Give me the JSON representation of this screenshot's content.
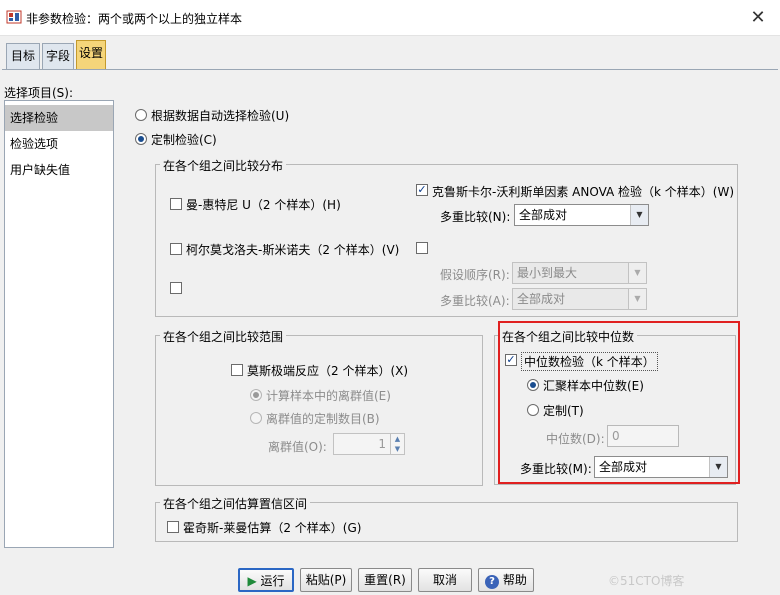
{
  "window": {
    "title": "非参数检验：两个或两个以上的独立样本",
    "close_glyph": "✕"
  },
  "tabs": [
    {
      "label": "目标",
      "active": false
    },
    {
      "label": "字段",
      "active": false
    },
    {
      "label": "设置",
      "active": true
    }
  ],
  "left_panel": {
    "heading": "选择项目(S):",
    "items": [
      {
        "label": "选择检验",
        "selected": true
      },
      {
        "label": "检验选项",
        "selected": false
      },
      {
        "label": "用户缺失值",
        "selected": false
      }
    ]
  },
  "mode": {
    "auto_label": "根据数据自动选择检验(U)",
    "custom_label": "定制检验(C)",
    "selected": "custom"
  },
  "compare_distributions": {
    "legend": "在各个组之间比较分布",
    "mann_whitney": {
      "label": "曼-惠特尼 U（2 个样本）(H)",
      "checked": false
    },
    "kruskal_wallis": {
      "label": "克鲁斯卡尔-沃利斯单因素 ANOVA 检验（k 个样本）(W)",
      "checked": true
    },
    "multiple_comparisons_label": "多重比较(N):",
    "multiple_comparisons_value": "全部成对",
    "kolmogorov_smirnov": {
      "label": "柯尔莫戈洛夫-斯米诺夫（2 个样本）(V)",
      "checked": false
    },
    "unlabeled_check_1": false,
    "unlabeled_check_2": false,
    "hypothesis_order_label": "假设顺序(R):",
    "hypothesis_order_value": "最小到最大",
    "multiple_comparisons_2_label": "多重比较(A):",
    "multiple_comparisons_2_value": "全部成对"
  },
  "compare_ranges": {
    "legend": "在各个组之间比较范围",
    "moses": {
      "label": "莫斯极端反应（2 个样本）(X)",
      "checked": false
    },
    "compute_outliers_label": "计算样本中的离群值(E)",
    "custom_outliers_label": "离群值的定制数目(B)",
    "outliers_label": "离群值(O):",
    "outliers_value": "1"
  },
  "compare_medians": {
    "legend": "在各个组之间比较中位数",
    "median_test": {
      "label": "中位数检验（k 个样本）",
      "checked": true
    },
    "pooled_label": "汇聚样本中位数(E)",
    "custom_label": "定制(T)",
    "selected": "pooled",
    "median_label": "中位数(D):",
    "median_value": "0",
    "multiple_comparisons_label": "多重比较(M):",
    "multiple_comparisons_value": "全部成对"
  },
  "confidence": {
    "legend": "在各个组之间估算置信区间",
    "hodges_lehmann": {
      "label": "霍奇斯-莱曼估算（2 个样本）(G)",
      "checked": false
    }
  },
  "buttons": {
    "run": "运行",
    "paste": "粘贴(P)",
    "reset": "重置(R)",
    "cancel": "取消",
    "help": "帮助"
  },
  "watermark": "©51CTO博客",
  "colors": {
    "active_tab": "#f5d57a",
    "highlight_box": "#e02020",
    "radio_dot": "#1a4d8f"
  }
}
